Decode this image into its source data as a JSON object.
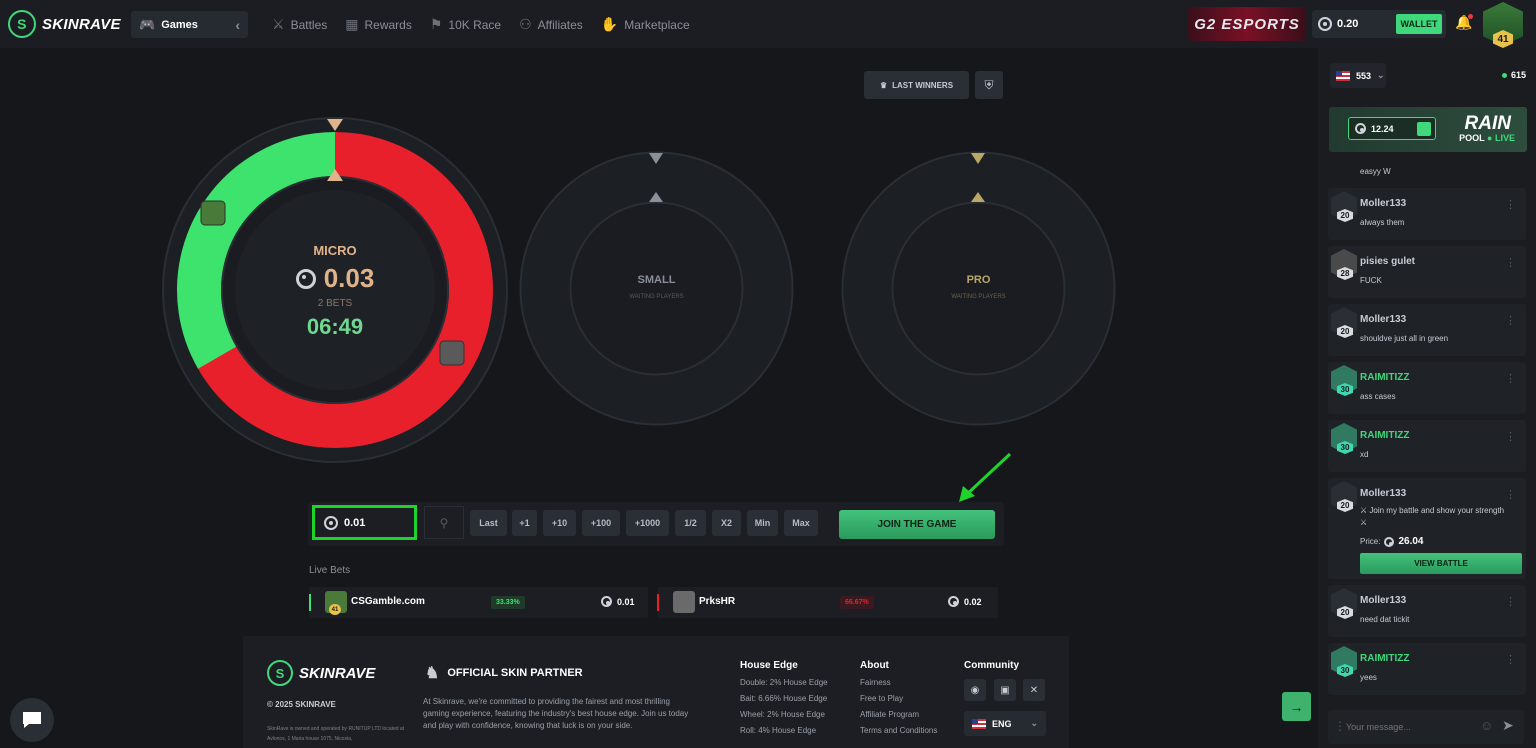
{
  "header": {
    "brand": "SKINRAVE",
    "games_label": "Games",
    "nav": [
      {
        "label": "Battles",
        "icon": "swords-icon"
      },
      {
        "label": "Rewards",
        "icon": "gift-icon"
      },
      {
        "label": "10K Race",
        "icon": "flag-icon"
      },
      {
        "label": "Affiliates",
        "icon": "user-plus-icon"
      },
      {
        "label": "Marketplace",
        "icon": "handshake-icon"
      }
    ],
    "esports_banner": "G2 ESPORTS",
    "balance": "0.20",
    "wallet_label": "WALLET",
    "user_level": "41"
  },
  "game": {
    "last_winners_label": "LAST WINNERS",
    "wheels": [
      {
        "name": "MICRO",
        "amount": "0.03",
        "bets": "2 BETS",
        "timer": "06:49",
        "green_pct": 0.3333,
        "red_pct": 0.6667
      },
      {
        "name": "SMALL",
        "status": "WAITING PLAYERS"
      },
      {
        "name": "PRO",
        "status": "WAITING PLAYERS"
      }
    ],
    "colors": {
      "green": "#3de36c",
      "red": "#e8202c",
      "ring_dark": "#1e2126"
    }
  },
  "betbar": {
    "amount": "0.01",
    "chips": [
      "Last",
      "+1",
      "+10",
      "+100",
      "+1000",
      "1/2",
      "X2",
      "Min",
      "Max"
    ],
    "join_label": "JOIN THE GAME"
  },
  "live_bets": {
    "title": "Live Bets",
    "rows": [
      {
        "user": "CSGamble.com",
        "level": "41",
        "pct": "33.33%",
        "amount": "0.01",
        "color": "#3de36c"
      },
      {
        "user": "PrksHR",
        "pct": "66.67%",
        "amount": "0.02",
        "color": "#e8202c"
      }
    ]
  },
  "footer": {
    "brand": "SKINRAVE",
    "copyright": "© 2025 SKINRAVE",
    "legal": "SkinRave is owned and operated by RUNITUP LTD located at Avlonos, 1 Maria house 1075, Nicosia,",
    "partner_title": "OFFICIAL SKIN PARTNER",
    "about_text": "At Skinrave, we're committed to providing the fairest and most thrilling gaming experience, featuring the industry's best house edge. Join us today and play with confidence, knowing that luck is on your side.",
    "house_edge": {
      "title": "House Edge",
      "items": [
        "Double: 2% House Edge",
        "Bait: 6.66% House Edge",
        "Wheel: 2% House Edge",
        "Roll: 4% House Edge"
      ]
    },
    "about": {
      "title": "About",
      "items": [
        "Fairness",
        "Free to Play",
        "Affiliate Program",
        "Terms and Conditions"
      ]
    },
    "community": {
      "title": "Community"
    },
    "language": "ENG"
  },
  "sidebar": {
    "online_users": "553",
    "online_count": "615",
    "rain": {
      "amount": "12.24",
      "title": "RAIN",
      "pool": "POOL",
      "live": "LIVE"
    },
    "partial_msg": "easyy W",
    "messages": [
      {
        "user": "Moller133",
        "level": "20",
        "text": "always them"
      },
      {
        "user": "pisies gulet",
        "level": "28",
        "text": "FUCK"
      },
      {
        "user": "Moller133",
        "level": "20",
        "text": "shouldve just all in green"
      },
      {
        "user": "RAIMITIZZ",
        "level": "30",
        "text": "ass cases"
      },
      {
        "user": "RAIMITIZZ",
        "level": "30",
        "text": "xd"
      },
      {
        "user": "Moller133",
        "level": "20",
        "text": "⚔ Join my battle and show your strength ⚔",
        "price_label": "Price:",
        "price": "26.04",
        "button": "VIEW BATTLE"
      },
      {
        "user": "Moller133",
        "level": "20",
        "text": "need dat tickit"
      },
      {
        "user": "RAIMITIZZ",
        "level": "30",
        "text": "yees"
      }
    ],
    "input_placeholder": "Your message..."
  }
}
